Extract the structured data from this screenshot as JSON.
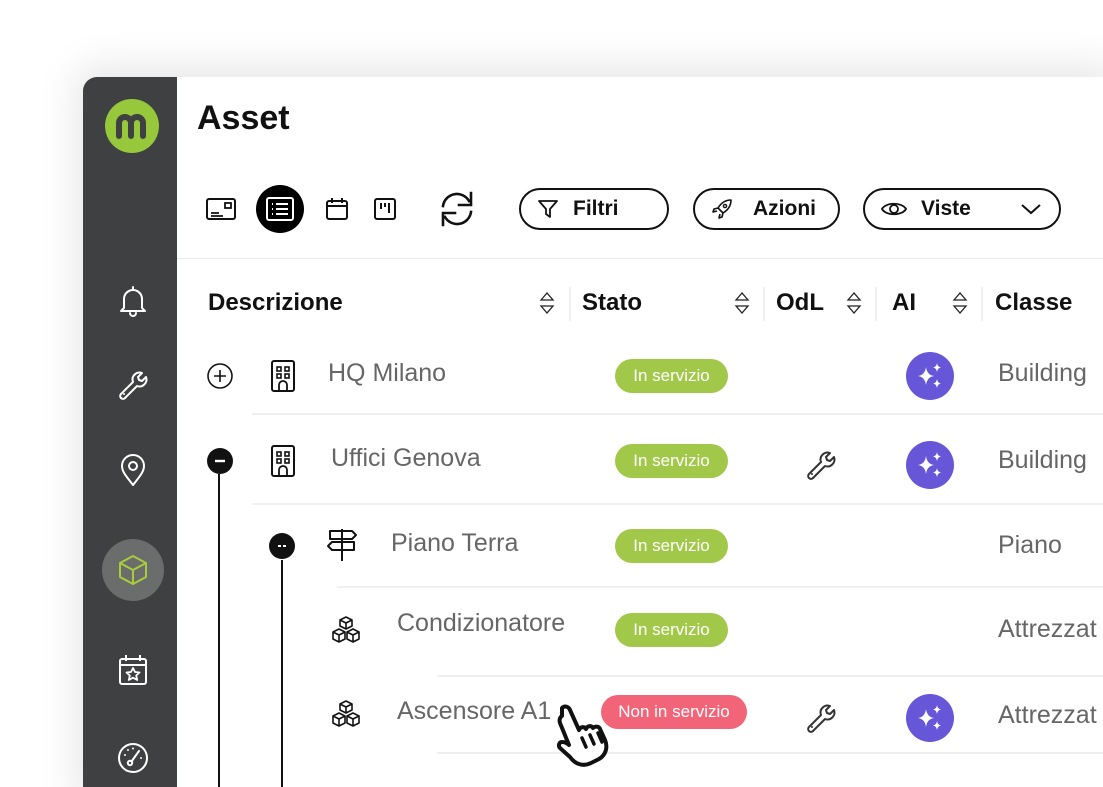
{
  "app": {
    "logo_letter": "m",
    "brand_color": "#97c83c",
    "sidebar_bg": "#3f4041"
  },
  "sidebar": {
    "items": [
      {
        "name": "notifications",
        "icon": "bell-icon",
        "active": false
      },
      {
        "name": "maintenance",
        "icon": "wrench-icon",
        "active": false
      },
      {
        "name": "locations",
        "icon": "map-pin-icon",
        "active": false
      },
      {
        "name": "assets",
        "icon": "cube-icon",
        "active": true
      },
      {
        "name": "planning",
        "icon": "calendar-star-icon",
        "active": false
      },
      {
        "name": "dashboard",
        "icon": "gauge-icon",
        "active": false
      }
    ]
  },
  "header": {
    "title": "Asset"
  },
  "toolbar": {
    "views": [
      {
        "name": "card-view",
        "icon": "card-icon",
        "active": false
      },
      {
        "name": "list-view",
        "icon": "list-icon",
        "active": true
      },
      {
        "name": "calendar-view",
        "icon": "calendar-icon",
        "active": false
      },
      {
        "name": "kanban-view",
        "icon": "kanban-icon",
        "active": false
      }
    ],
    "refresh_icon": "refresh-icon",
    "filters_label": "Filtri",
    "actions_label": "Azioni",
    "views_label": "Viste"
  },
  "table": {
    "columns": [
      {
        "key": "descrizione",
        "label": "Descrizione",
        "sortable": true
      },
      {
        "key": "stato",
        "label": "Stato",
        "sortable": true
      },
      {
        "key": "odl",
        "label": "OdL",
        "sortable": true
      },
      {
        "key": "ai",
        "label": "AI",
        "sortable": true
      },
      {
        "key": "classe",
        "label": "Classe",
        "sortable": false
      }
    ],
    "rows": [
      {
        "name": "HQ Milano",
        "level": 0,
        "toggle": "expand",
        "type_icon": "building-icon",
        "status": "In servizio",
        "status_kind": "ok",
        "odl": false,
        "ai": true,
        "classe": "Building"
      },
      {
        "name": "Uffici Genova",
        "level": 0,
        "toggle": "collapse",
        "type_icon": "building-icon",
        "status": "In servizio",
        "status_kind": "ok",
        "odl": true,
        "ai": true,
        "classe": "Building"
      },
      {
        "name": "Piano Terra",
        "level": 1,
        "toggle": "collapse",
        "type_icon": "signpost-icon",
        "status": "In servizio",
        "status_kind": "ok",
        "odl": false,
        "ai": false,
        "classe": "Piano"
      },
      {
        "name": "Condizionatore",
        "level": 2,
        "toggle": null,
        "type_icon": "boxes-icon",
        "status": "In servizio",
        "status_kind": "ok",
        "odl": false,
        "ai": false,
        "classe": "Attrezzat"
      },
      {
        "name": "Ascensore A1",
        "level": 2,
        "toggle": null,
        "type_icon": "boxes-icon",
        "status": "Non in servizio",
        "status_kind": "ko",
        "odl": true,
        "ai": true,
        "classe": "Attrezzat"
      }
    ]
  },
  "colors": {
    "status_ok": "#a2c84a",
    "status_ko": "#f26477",
    "ai_purple": "#6856d9"
  }
}
